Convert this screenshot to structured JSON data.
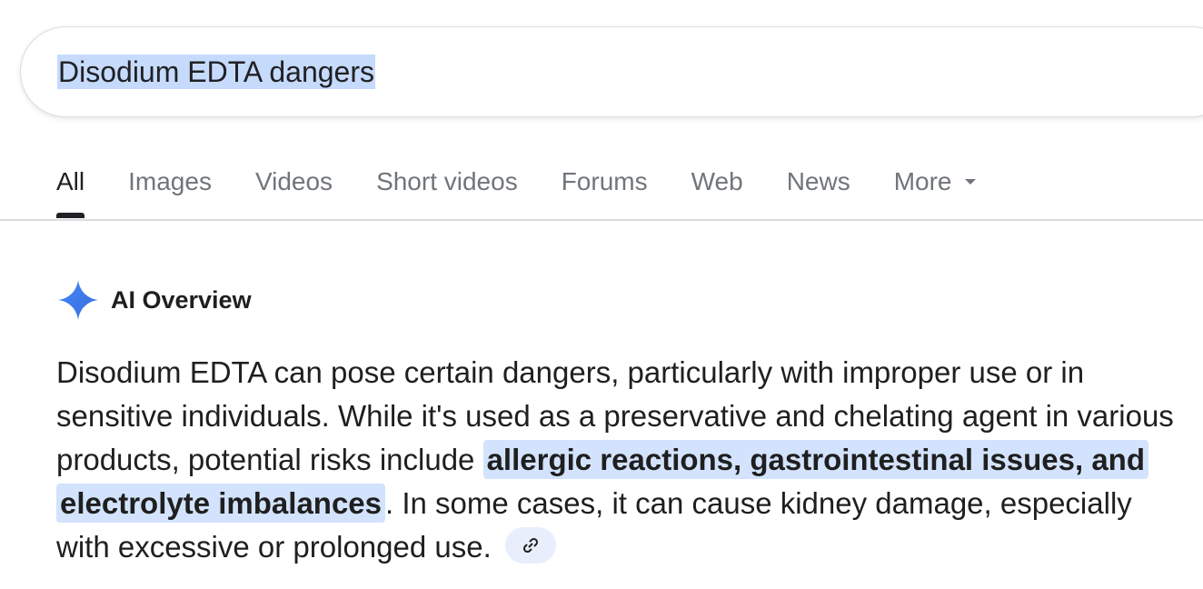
{
  "search": {
    "query": "Disodium EDTA dangers"
  },
  "tabs": [
    {
      "label": "All",
      "active": true
    },
    {
      "label": "Images"
    },
    {
      "label": "Videos"
    },
    {
      "label": "Short videos"
    },
    {
      "label": "Forums"
    },
    {
      "label": "Web"
    },
    {
      "label": "News"
    },
    {
      "label": "More",
      "has_dropdown": true
    }
  ],
  "ai_overview": {
    "label": "AI Overview",
    "icon": "sparkle-icon",
    "text_before": "Disodium EDTA can pose certain dangers, particularly with improper use or in sensitive individuals. While it's used as a preservative and chelating agent in various products, potential risks include ",
    "highlight": "allergic reactions, gastrointestinal issues, and electrolyte imbalances",
    "text_after": ". In some cases, it can cause kidney damage, especially with excessive or prolonged use.",
    "link_icon": "link-icon"
  },
  "colors": {
    "accent_blue": "#4285f4",
    "query_selection": "#c6dafc",
    "highlight_bg": "#d3e3fd",
    "active_tab": "#202124",
    "inactive_tab": "#70757a"
  }
}
